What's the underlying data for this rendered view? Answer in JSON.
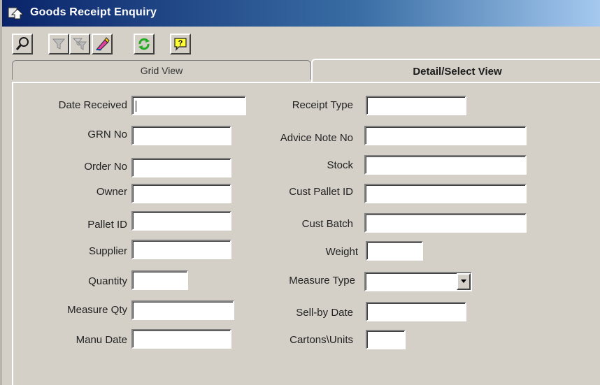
{
  "window": {
    "title": "Goods Receipt Enquiry"
  },
  "toolbar": [
    {
      "name": "search-button",
      "icon": "magnifier-icon"
    },
    {
      "name": "filter-button",
      "icon": "funnel-icon"
    },
    {
      "name": "filter-clear-button",
      "icon": "funnel-multi-icon"
    },
    {
      "name": "clear-fields-button",
      "icon": "eraser-icon"
    },
    {
      "name": "refresh-button",
      "icon": "refresh-icon"
    },
    {
      "name": "help-button",
      "icon": "help-icon"
    }
  ],
  "tabs": {
    "grid_label": "Grid View",
    "detail_label": "Detail/Select View"
  },
  "fields_left": [
    {
      "key": "date_received",
      "label": "Date Received",
      "value": ""
    },
    {
      "key": "grn_no",
      "label": "GRN No",
      "value": ""
    },
    {
      "key": "order_no",
      "label": "Order No",
      "value": ""
    },
    {
      "key": "owner",
      "label": "Owner",
      "value": ""
    },
    {
      "key": "pallet_id",
      "label": "Pallet ID",
      "value": ""
    },
    {
      "key": "supplier",
      "label": "Supplier",
      "value": ""
    },
    {
      "key": "quantity",
      "label": "Quantity",
      "value": ""
    },
    {
      "key": "measure_qty",
      "label": "Measure Qty",
      "value": ""
    },
    {
      "key": "manu_date",
      "label": "Manu Date",
      "value": ""
    }
  ],
  "fields_right": [
    {
      "key": "receipt_type",
      "label": "Receipt Type",
      "value": ""
    },
    {
      "key": "advice_note_no",
      "label": "Advice Note No",
      "value": ""
    },
    {
      "key": "stock",
      "label": "Stock",
      "value": ""
    },
    {
      "key": "cust_pallet_id",
      "label": "Cust Pallet ID",
      "value": ""
    },
    {
      "key": "cust_batch",
      "label": "Cust Batch",
      "value": ""
    },
    {
      "key": "weight",
      "label": "Weight",
      "value": ""
    },
    {
      "key": "measure_type",
      "label": "Measure Type",
      "value": ""
    },
    {
      "key": "sell_by_date",
      "label": "Sell-by Date",
      "value": ""
    },
    {
      "key": "cartons_units",
      "label": "Cartons\\Units",
      "value": ""
    }
  ]
}
